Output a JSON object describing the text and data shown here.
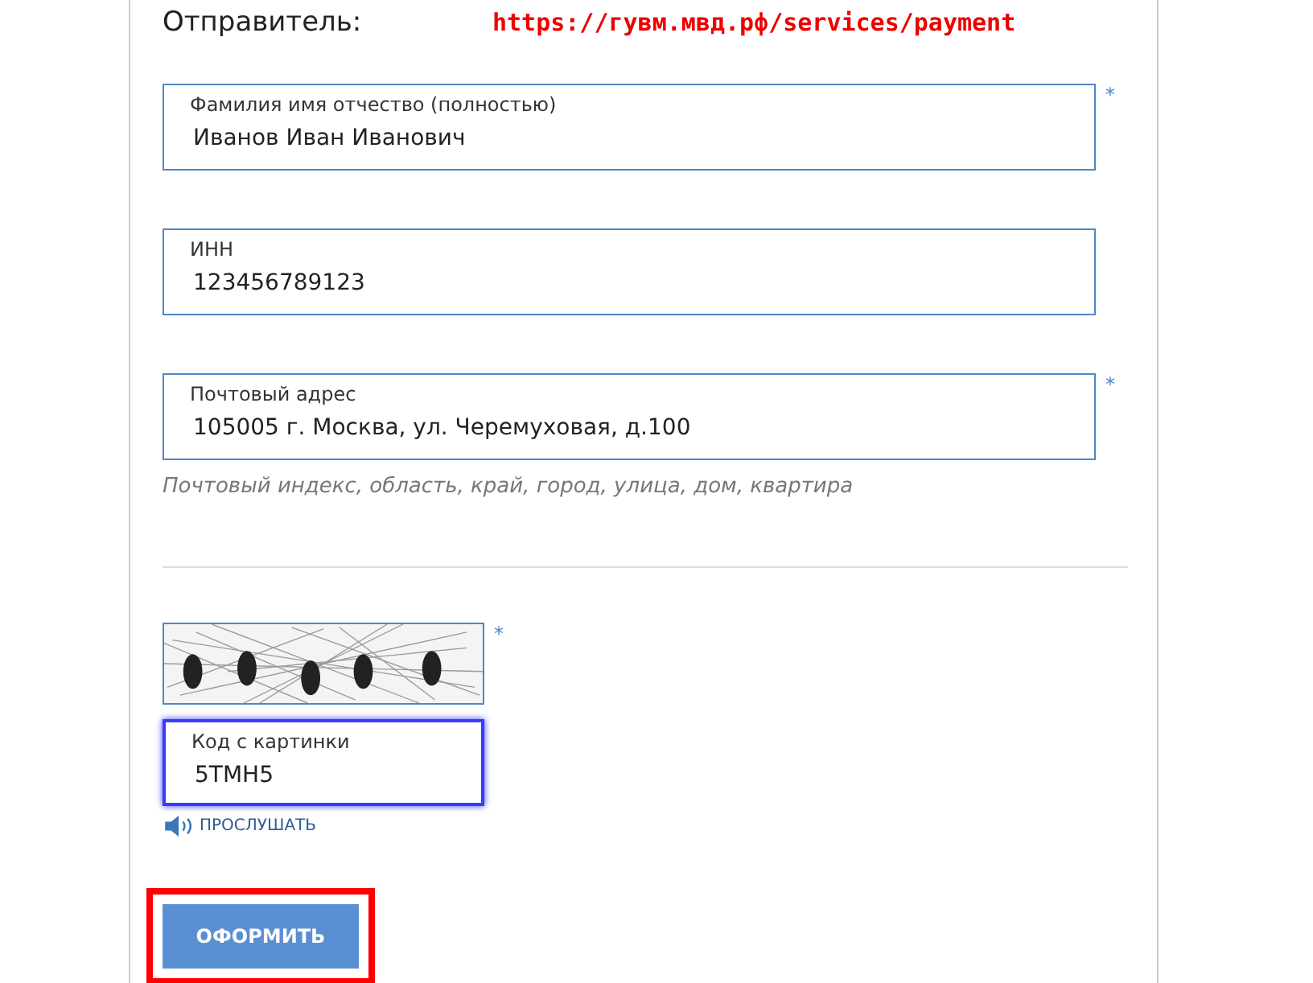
{
  "section_title": "Отправитель:",
  "annotation_url": "https://гувм.мвд.рф/services/payment",
  "fields": [
    {
      "label": "Фамилия имя отчество (полностью)",
      "value": "Иванов Иван Иванович",
      "required_mark": "*"
    },
    {
      "label": "ИНН",
      "value": "123456789123"
    },
    {
      "label": "Почтовый адрес",
      "value": "105005 г. Москва, ул. Черемуховая, д.100",
      "required_mark": "*",
      "hint": "Почтовый индекс, область, край, город, улица, дом, квартира"
    }
  ],
  "captcha": {
    "kind": "picture",
    "required_mark": "*",
    "field": {
      "label": "Код с картинки",
      "value": "5TMH5",
      "focused": true
    },
    "listen": "ПРОСЛУШАТЬ"
  },
  "submit_button": {
    "label": "ОФОРМИТЬ",
    "highlighted": true
  }
}
